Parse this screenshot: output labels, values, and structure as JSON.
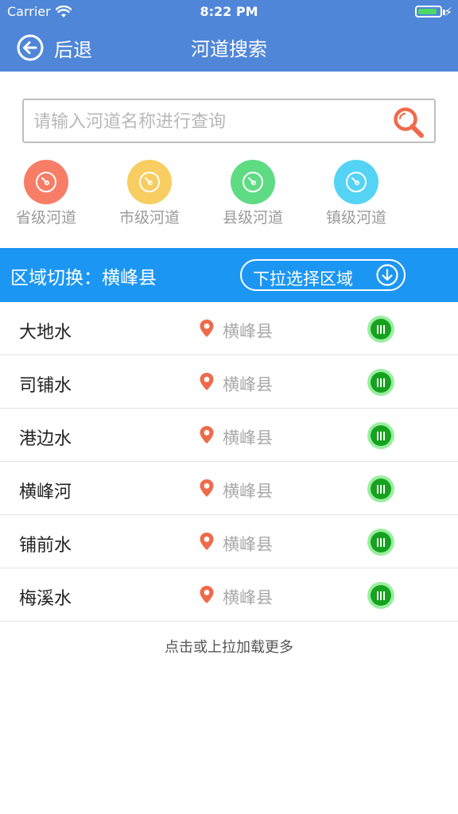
{
  "status_bar": {
    "carrier": "Carrier",
    "time": "8:22 PM",
    "battery_level": 0.9
  },
  "nav": {
    "back_label": "后退",
    "title": "河道搜索"
  },
  "search": {
    "placeholder": "请输入河道名称进行查询",
    "value": ""
  },
  "categories": [
    {
      "label": "省级河道",
      "color": "#f77d67"
    },
    {
      "label": "市级河道",
      "color": "#f8cd61"
    },
    {
      "label": "县级河道",
      "color": "#5fdb84"
    },
    {
      "label": "镇级河道",
      "color": "#54d3f5"
    }
  ],
  "region": {
    "label": "区域切换：横峰县",
    "button_label": "下拉选择区域"
  },
  "rivers": [
    {
      "name": "大地水",
      "area": "横峰县"
    },
    {
      "name": "司铺水",
      "area": "横峰县"
    },
    {
      "name": "港边水",
      "area": "横峰县"
    },
    {
      "name": "横峰河",
      "area": "横峰县"
    },
    {
      "name": "铺前水",
      "area": "横峰县"
    },
    {
      "name": "梅溪水",
      "area": "横峰县"
    }
  ],
  "load_more": "点击或上拉加载更多",
  "colors": {
    "nav_bg": "#4f86d8",
    "region_bg": "#1c96f3",
    "accent_orange": "#ef6a4b",
    "badge_green": "#16a21e"
  },
  "icons": {
    "back": "arrow-left-circle-icon",
    "search": "magnifier-icon",
    "pin": "location-pin-icon",
    "status": "level-badge-icon",
    "dropdown": "arrow-down-circle-icon",
    "category": "compass-icon"
  }
}
